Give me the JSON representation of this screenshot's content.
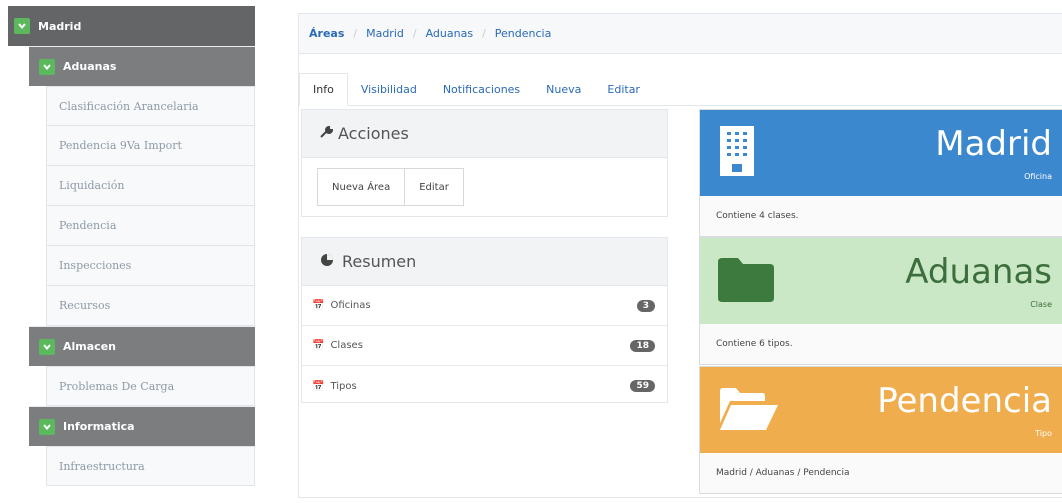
{
  "sidebar": {
    "root": "Madrid",
    "groups": [
      {
        "label": "Aduanas",
        "items": [
          "Clasificación Arancelaria",
          "Pendencia 9Va Import",
          "Liquidación",
          "Pendencia",
          "Inspecciones",
          "Recursos"
        ]
      },
      {
        "label": "Almacen",
        "items": [
          "Problemas De Carga"
        ]
      },
      {
        "label": "Informatica",
        "items": [
          "Infraestructura"
        ]
      }
    ]
  },
  "breadcrumb": [
    "Áreas",
    "Madrid",
    "Aduanas",
    "Pendencia"
  ],
  "tabs": [
    "Info",
    "Visibilidad",
    "Notificaciones",
    "Nueva",
    "Editar"
  ],
  "acciones": {
    "title": "Acciones",
    "buttons": [
      "Nueva Área",
      "Editar"
    ]
  },
  "resumen": {
    "title": "Resumen",
    "rows": [
      {
        "label": "Oficinas",
        "count": "3"
      },
      {
        "label": "Clases",
        "count": "18"
      },
      {
        "label": "Tipos",
        "count": "59"
      }
    ]
  },
  "cards": [
    {
      "title": "Madrid",
      "subtitle": "Oficina",
      "footer": "Contiene 4 clases.",
      "color": "#3c88cf"
    },
    {
      "title": "Aduanas",
      "subtitle": "Clase",
      "footer": "Contiene 6 tipos.",
      "color": "#cbe8c6"
    },
    {
      "title": "Pendencia",
      "subtitle": "Tipo",
      "footer": "Madrid / Aduanas / Pendencia",
      "color": "#f0ad4e"
    }
  ]
}
